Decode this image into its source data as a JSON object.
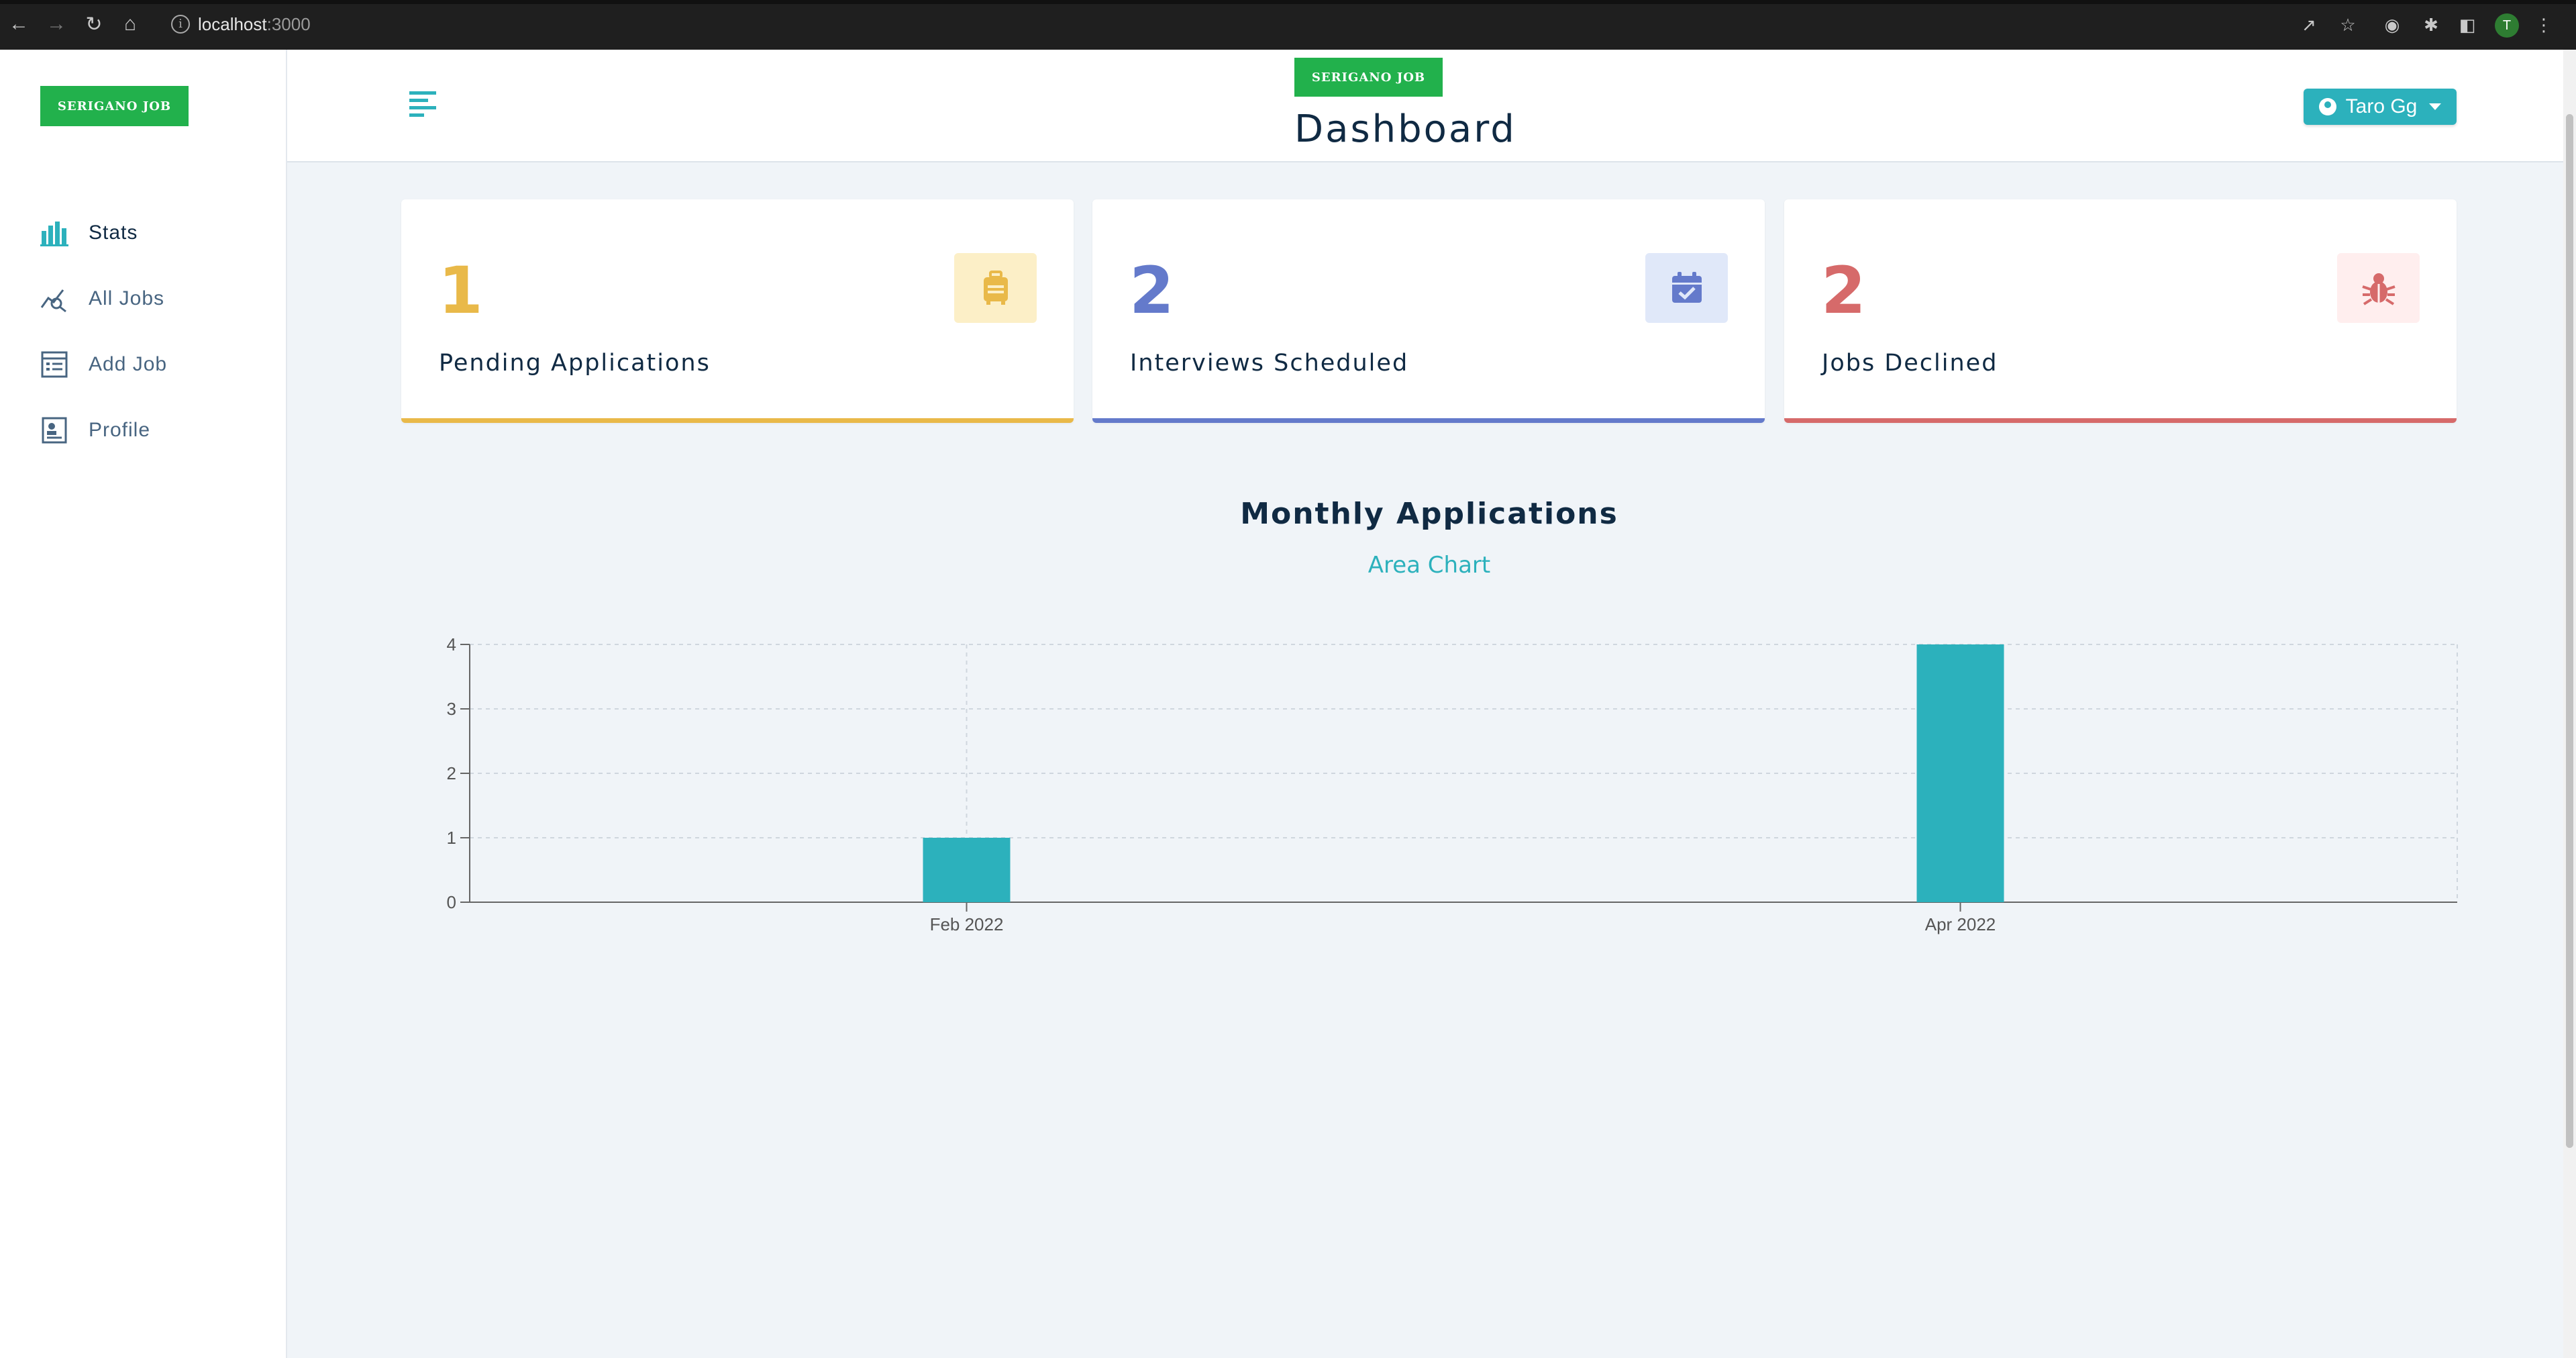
{
  "browser": {
    "url_host": "localhost",
    "url_port": ":3000",
    "profile_initial": "T"
  },
  "sidebar": {
    "logo_label": "SERIGANO JOB",
    "items": [
      {
        "label": "Stats",
        "icon": "bar-chart-icon",
        "active": true
      },
      {
        "label": "All Jobs",
        "icon": "query-stats-icon",
        "active": false
      },
      {
        "label": "Add Job",
        "icon": "form-icon",
        "active": false
      },
      {
        "label": "Profile",
        "icon": "profile-icon",
        "active": false
      }
    ]
  },
  "navbar": {
    "logo_label": "SERIGANO JOB",
    "title": "Dashboard",
    "user_name": "Taro Gg"
  },
  "stats": [
    {
      "count": "1",
      "title": "Pending Applications",
      "icon": "suitcase-icon",
      "color": "#e9b949",
      "bg": "#fcefc7"
    },
    {
      "count": "2",
      "title": "Interviews Scheduled",
      "icon": "calendar-check-icon",
      "color": "#647acb",
      "bg": "#e0e8f9"
    },
    {
      "count": "2",
      "title": "Jobs Declined",
      "icon": "bug-icon",
      "color": "#d66a6a",
      "bg": "#ffeeee"
    }
  ],
  "chart": {
    "title": "Monthly Applications",
    "toggle_label": "Area Chart"
  },
  "chart_data": {
    "type": "bar",
    "categories": [
      "Feb 2022",
      "Apr 2022"
    ],
    "values": [
      1,
      4
    ],
    "title": "Monthly Applications",
    "xlabel": "",
    "ylabel": "",
    "ylim": [
      0,
      4
    ],
    "yticks": [
      "0",
      "1",
      "2",
      "3",
      "4"
    ],
    "grid": true,
    "bar_color": "#2cb1bc"
  }
}
